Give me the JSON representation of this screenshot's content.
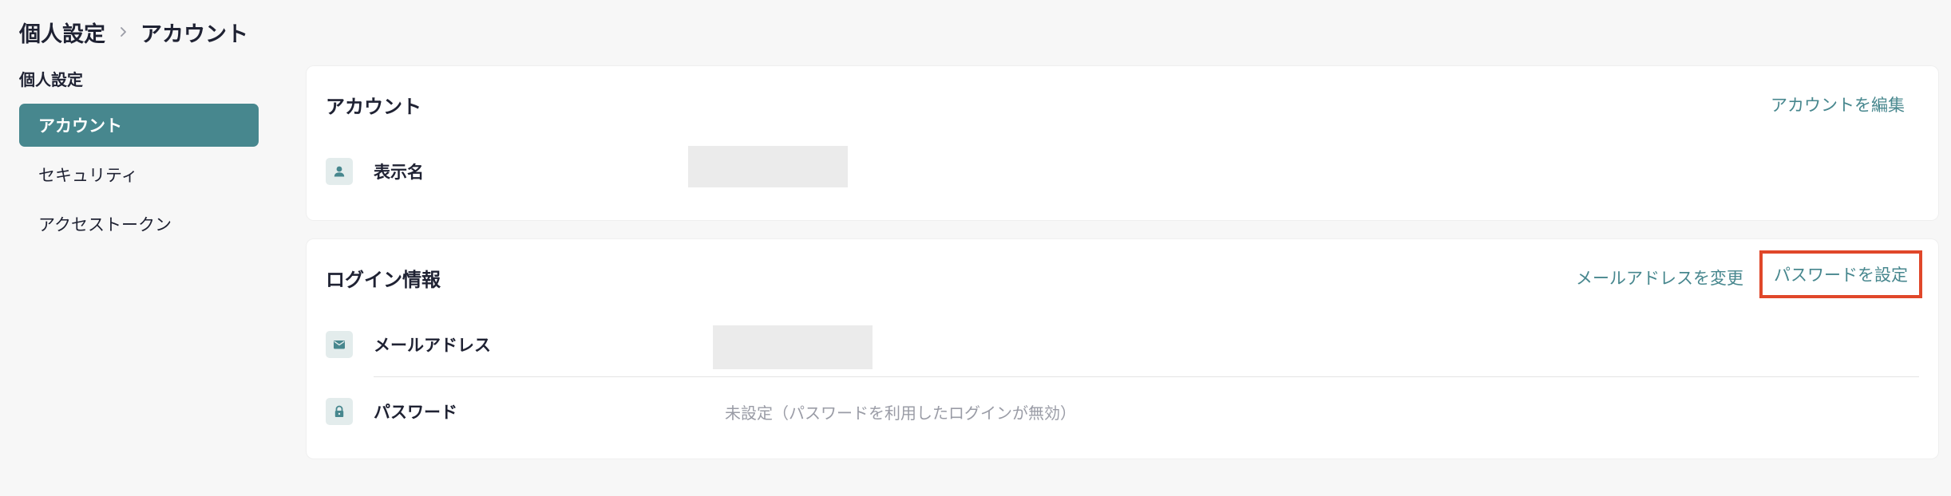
{
  "breadcrumb": {
    "parent": "個人設定",
    "current": "アカウント"
  },
  "sidebar": {
    "section_title": "個人設定",
    "items": [
      {
        "label": "アカウント",
        "active": true
      },
      {
        "label": "セキュリティ",
        "active": false
      },
      {
        "label": "アクセストークン",
        "active": false
      }
    ]
  },
  "account_card": {
    "title": "アカウント",
    "edit_label": "アカウントを編集",
    "rows": [
      {
        "icon": "person-icon",
        "label": "表示名",
        "value": ""
      }
    ]
  },
  "login_card": {
    "title": "ログイン情報",
    "change_email_label": "メールアドレスを変更",
    "set_password_label": "パスワードを設定",
    "rows": [
      {
        "icon": "mail-icon",
        "label": "メールアドレス",
        "value": ""
      },
      {
        "icon": "lock-icon",
        "label": "パスワード",
        "value": "未設定（パスワードを利用したログインが無効）"
      }
    ]
  },
  "colors": {
    "accent": "#47878e",
    "highlight": "#e0472a",
    "background": "#f7f7f7"
  }
}
